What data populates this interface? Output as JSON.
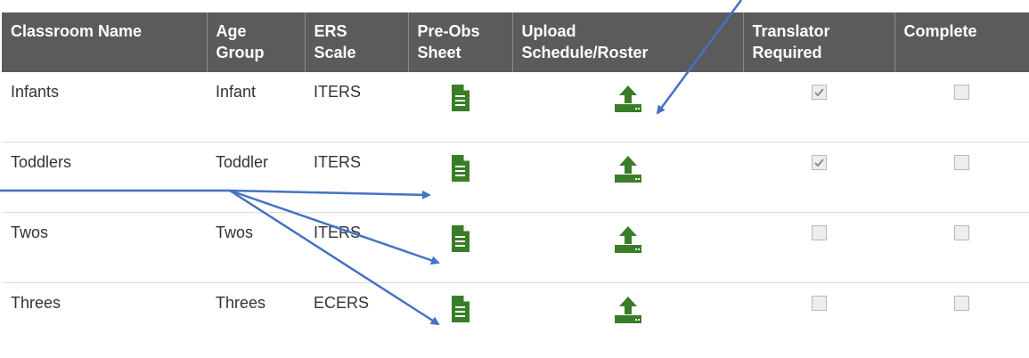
{
  "headers": {
    "classroom_name": "Classroom Name",
    "age_group_line1": "Age",
    "age_group_line2": "Group",
    "ers_scale_line1": "ERS",
    "ers_scale_line2": "Scale",
    "preobs_line1": "Pre-Obs",
    "preobs_line2": "Sheet",
    "upload_line1": "Upload",
    "upload_line2": "Schedule/Roster",
    "translator_line1": "Translator",
    "translator_line2": "Required",
    "complete": "Complete"
  },
  "rows": [
    {
      "classroom": "Infants",
      "age_group": "Infant",
      "ers_scale": "ITERS",
      "translator_required": true,
      "complete": false
    },
    {
      "classroom": "Toddlers",
      "age_group": "Toddler",
      "ers_scale": "ITERS",
      "translator_required": true,
      "complete": false
    },
    {
      "classroom": "Twos",
      "age_group": "Twos",
      "ers_scale": "ITERS",
      "translator_required": false,
      "complete": false
    },
    {
      "classroom": "Threes",
      "age_group": "Threes",
      "ers_scale": "ECERS",
      "translator_required": false,
      "complete": false
    }
  ],
  "icons": {
    "preobs": "document-icon",
    "upload": "upload-icon"
  },
  "colors": {
    "header_bg": "#5b5b5b",
    "icon_green": "#3a7d28",
    "annotation_arrow": "#4472c4"
  }
}
